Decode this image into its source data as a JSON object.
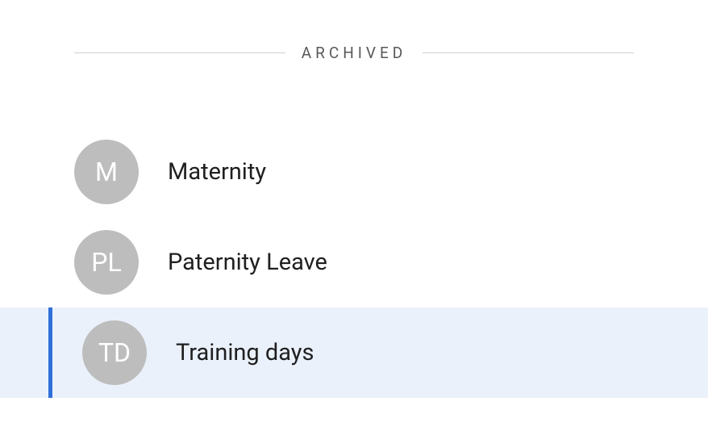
{
  "section": {
    "title": "ARCHIVED"
  },
  "items": [
    {
      "initials": "M",
      "label": "Maternity",
      "selected": false
    },
    {
      "initials": "PL",
      "label": "Paternity Leave",
      "selected": false
    },
    {
      "initials": "TD",
      "label": "Training days",
      "selected": true
    }
  ]
}
